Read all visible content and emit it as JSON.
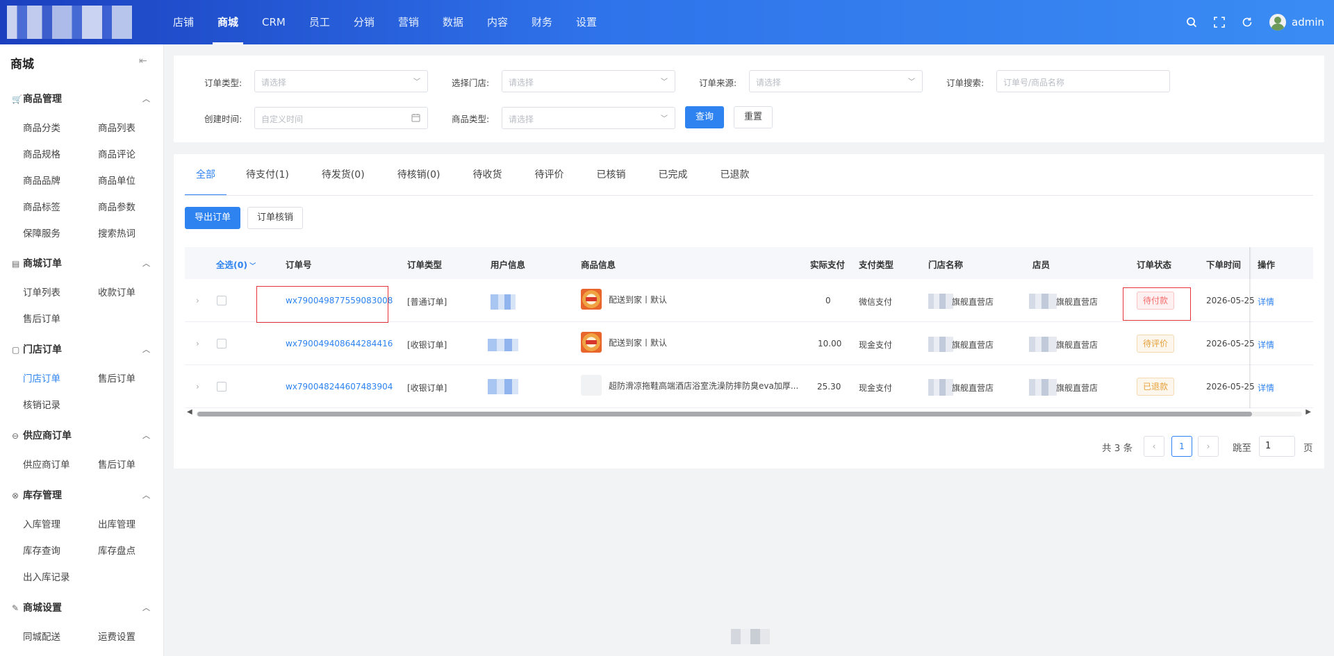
{
  "nav": {
    "items": [
      "店铺",
      "商城",
      "CRM",
      "员工",
      "分销",
      "营销",
      "数据",
      "内容",
      "财务",
      "设置"
    ],
    "active": "商城",
    "user": "admin"
  },
  "sidebar": {
    "title": "商城",
    "groups": [
      {
        "title": "商品管理",
        "items": [
          "商品分类",
          "商品列表",
          "商品规格",
          "商品评论",
          "商品品牌",
          "商品单位",
          "商品标签",
          "商品参数",
          "保障服务",
          "搜索热词"
        ]
      },
      {
        "title": "商城订单",
        "items": [
          "订单列表",
          "收款订单",
          "售后订单"
        ]
      },
      {
        "title": "门店订单",
        "items": [
          "门店订单",
          "售后订单",
          "核销记录"
        ]
      },
      {
        "title": "供应商订单",
        "items": [
          "供应商订单",
          "售后订单"
        ]
      },
      {
        "title": "库存管理",
        "items": [
          "入库管理",
          "出库管理",
          "库存查询",
          "库存盘点",
          "出入库记录"
        ]
      },
      {
        "title": "商城设置",
        "items": [
          "同城配送",
          "运费设置"
        ]
      }
    ],
    "active_item": "门店订单"
  },
  "filters": {
    "order_type_label": "订单类型:",
    "order_type_placeholder": "请选择",
    "store_label": "选择门店:",
    "store_placeholder": "请选择",
    "source_label": "订单来源:",
    "source_placeholder": "请选择",
    "search_label": "订单搜索:",
    "search_placeholder": "订单号/商品名称",
    "created_label": "创建时间:",
    "created_placeholder": "自定义时间",
    "goods_type_label": "商品类型:",
    "goods_type_placeholder": "请选择",
    "query_btn": "查询",
    "reset_btn": "重置"
  },
  "tabs": [
    "全部",
    "待支付(1)",
    "待发货(0)",
    "待核销(0)",
    "待收货",
    "待评价",
    "已核销",
    "已完成",
    "已退款"
  ],
  "actions": {
    "export": "导出订单",
    "verify": "订单核销"
  },
  "table": {
    "select_all": "全选(0)",
    "headers": [
      "订单号",
      "订单类型",
      "用户信息",
      "商品信息",
      "实际支付",
      "支付类型",
      "门店名称",
      "店员",
      "订单状态",
      "下单时间",
      "操作"
    ],
    "rows": [
      {
        "order_no": "wx790049877559083008",
        "type": "[普通订单]",
        "product": "配送到家丨默认",
        "pay": "0",
        "pay_type": "微信支付",
        "store": "旗舰直营店",
        "clerk": "旗舰直营店",
        "status": "待付款",
        "status_color": "red",
        "time": "2026-05-25",
        "op": "详情"
      },
      {
        "order_no": "wx790049408644284416",
        "type": "[收银订单]",
        "product": "配送到家丨默认",
        "pay": "10.00",
        "pay_type": "现金支付",
        "store": "旗舰直营店",
        "clerk": "旗舰直营店",
        "status": "待评价",
        "status_color": "orange",
        "time": "2026-05-25",
        "op": "详情"
      },
      {
        "order_no": "wx790048244607483904",
        "type": "[收银订单]",
        "product": "超防滑凉拖鞋高端酒店浴室洗澡防摔防臭eva加厚...",
        "pay": "25.30",
        "pay_type": "现金支付",
        "store": "旗舰直营店",
        "clerk": "旗舰直营店",
        "status": "已退款",
        "status_color": "orange",
        "time": "2026-05-25",
        "op": "详情"
      }
    ]
  },
  "pagination": {
    "total": "共 3 条",
    "current": "1",
    "jump_label": "跳至",
    "jump_value": "1",
    "page_suffix": "页"
  }
}
